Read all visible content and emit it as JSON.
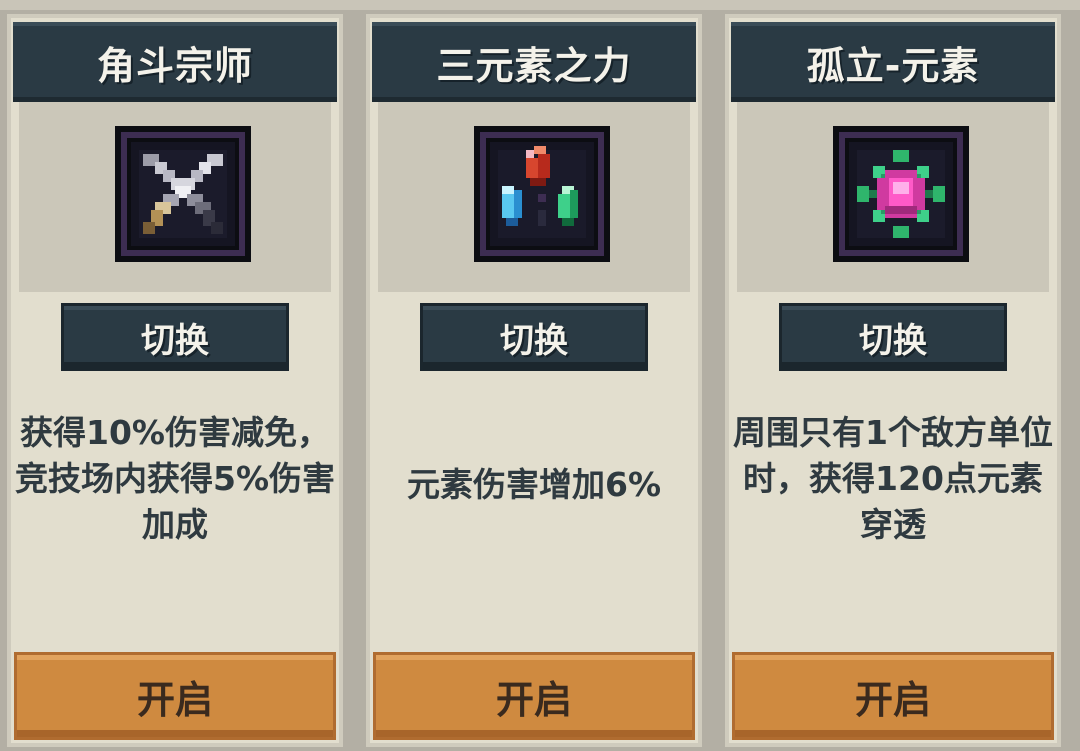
{
  "cards": [
    {
      "title": "角斗宗师",
      "icon": "crossed-swords-icon",
      "switch_label": "切换",
      "description": "获得10%伤害减免，竞技场内获得5%伤害加成",
      "open_label": "开启"
    },
    {
      "title": "三元素之力",
      "icon": "three-element-gems-icon",
      "switch_label": "切换",
      "description": "元素伤害增加6%",
      "open_label": "开启"
    },
    {
      "title": "孤立-元素",
      "icon": "isolated-element-orb-icon",
      "switch_label": "切换",
      "description": "周围只有1个敌方单位时，获得120点元素穿透",
      "open_label": "开启"
    }
  ],
  "colors": {
    "header_bg": "#2a3a44",
    "card_bg": "#e2dece",
    "open_button_bg": "#cf8a40",
    "icon_frame_border": "#3d2d52"
  }
}
